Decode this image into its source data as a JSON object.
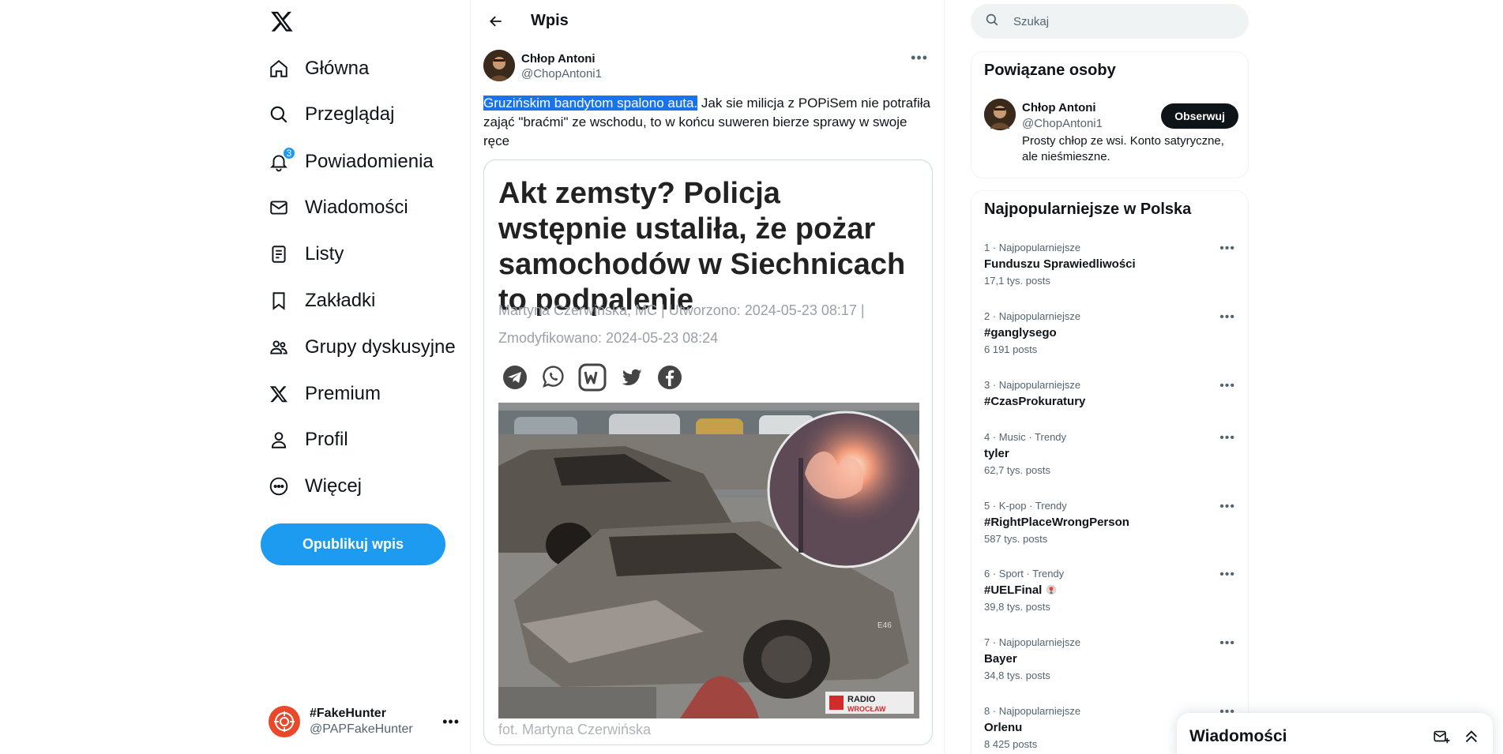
{
  "nav": {
    "items": [
      {
        "label": "Główna",
        "icon": "home-icon"
      },
      {
        "label": "Przeglądaj",
        "icon": "search-icon"
      },
      {
        "label": "Powiadomienia",
        "icon": "bell-icon",
        "badge": "3"
      },
      {
        "label": "Wiadomości",
        "icon": "mail-icon"
      },
      {
        "label": "Listy",
        "icon": "list-icon"
      },
      {
        "label": "Zakładki",
        "icon": "bookmark-icon"
      },
      {
        "label": "Grupy dyskusyjne",
        "icon": "communities-icon"
      },
      {
        "label": "Premium",
        "icon": "x-premium-icon"
      },
      {
        "label": "Profil",
        "icon": "person-icon"
      },
      {
        "label": "Więcej",
        "icon": "more-circle-icon"
      }
    ],
    "post_button": "Opublikuj wpis",
    "account": {
      "name": "#FakeHunter",
      "handle": "@PAPFakeHunter"
    }
  },
  "main": {
    "title": "Wpis",
    "tweet": {
      "author_name": "Chłop Antoni",
      "author_handle": "@ChopAntoni1",
      "text_highlighted": "Gruzińskim bandytom spalono auta.",
      "text_rest": " Jak sie milicja z POPiSem nie potrafiła zająć \"braćmi\" ze wschodu, to w końcu suweren bierze sprawy w swoje ręce",
      "card": {
        "headline": "Akt zemsty? Policja wstępnie ustaliła, że pożar samochodów w Siechnicach to podpalenie",
        "meta": "Martyna Czerwińska, MC | Utworzono: 2024-05-23 08:17 | Zmodyfikowano: 2024-05-23 08:24",
        "share_icons": [
          "telegram-icon",
          "whatsapp-icon",
          "wykop-icon",
          "twitter-icon",
          "facebook-icon"
        ],
        "photo_watermark_line1": "RADIO",
        "photo_watermark_line2": "WROCŁAW",
        "photo_plate_text": "E46",
        "caption": "fot. Martyna Czerwińska"
      }
    }
  },
  "right": {
    "search_placeholder": "Szukaj",
    "related": {
      "title": "Powiązane osoby",
      "name": "Chłop Antoni",
      "handle": "@ChopAntoni1",
      "follow": "Obserwuj",
      "bio": "Prosty chłop ze wsi. Konto satyryczne, ale nieśmieszne."
    },
    "trends": {
      "title": "Najpopularniejsze w Polska",
      "items": [
        {
          "meta": "1 · Najpopularniejsze",
          "title": "Funduszu Sprawiedliwości",
          "count": "17,1 tys. posts"
        },
        {
          "meta": "2 · Najpopularniejsze",
          "title": "#ganglysego",
          "count": "6 191 posts"
        },
        {
          "meta": "3 · Najpopularniejsze",
          "title": "#CzasProkuratury",
          "count": ""
        },
        {
          "meta": "4 · Music · Trendy",
          "title": "tyler",
          "count": "62,7 tys. posts"
        },
        {
          "meta": "5 · K-pop · Trendy",
          "title": "#RightPlaceWrongPerson",
          "count": "587 tys. posts"
        },
        {
          "meta": "6 · Sport · Trendy",
          "title": "#UELFinal",
          "count": "39,8 tys. posts"
        },
        {
          "meta": "7 · Najpopularniejsze",
          "title": "Bayer",
          "count": "34,8 tys. posts"
        },
        {
          "meta": "8 · Najpopularniejsze",
          "title": "Orlenu",
          "count": "8 425 posts"
        }
      ]
    }
  },
  "drawer": {
    "title": "Wiadomości"
  },
  "colors": {
    "accent": "#1d9bf0",
    "text": "#0f1419",
    "muted": "#536471",
    "highlight": "#1a73e8"
  }
}
